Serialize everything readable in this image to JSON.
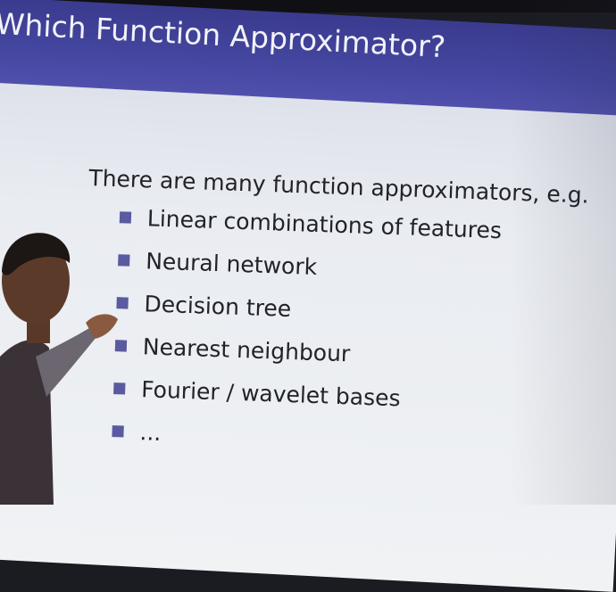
{
  "slide": {
    "title": "Which Function Approximator?",
    "intro": "There are many function approximators, e.g.",
    "bullets": [
      "Linear combinations of features",
      "Neural network",
      "Decision tree",
      "Nearest neighbour",
      "Fourier / wavelet bases",
      "..."
    ]
  },
  "colors": {
    "title_band": "#4446a0",
    "bullet_marker": "#5a5aa0",
    "slide_background": "#eef0f3",
    "text": "#222228"
  }
}
